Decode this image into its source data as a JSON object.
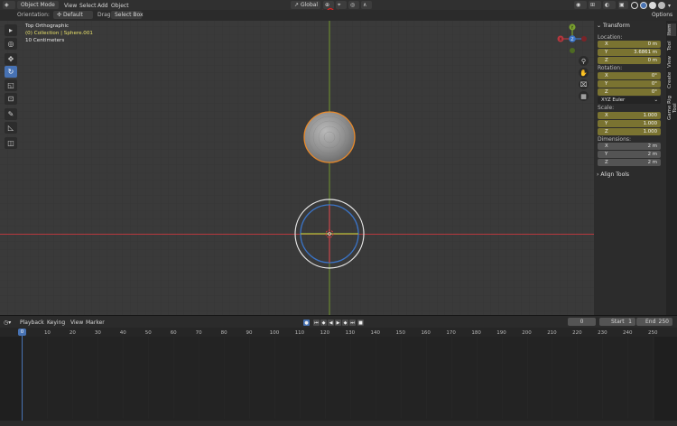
{
  "header": {
    "mode": "Object Mode",
    "menus": [
      "View",
      "Select",
      "Add",
      "Object"
    ],
    "transform_orientation": "Global",
    "options_label": "Options"
  },
  "tool_header": {
    "orientation_label": "Orientation:",
    "orientation_value": "Default",
    "drag_label": "Drag:",
    "drag_value": "Select Box"
  },
  "viewport": {
    "view_name": "Top Orthographic",
    "collection_info": "(0) Collection | Sphere.001",
    "scale_info": "10 Centimeters",
    "gizmo_labels": {
      "x": "X",
      "y": "Y",
      "z": "Z"
    }
  },
  "toolbar": {
    "tools": [
      "select-box",
      "cursor",
      "move",
      "rotate",
      "scale",
      "transform",
      "annotate",
      "measure",
      "add-cube"
    ],
    "active_index": 3
  },
  "sidebar": {
    "panel_title": "Transform",
    "location": {
      "label": "Location:",
      "x": "0 m",
      "y": "3.6861 m",
      "z": "0 m"
    },
    "rotation": {
      "label": "Rotation:",
      "x": "0°",
      "y": "0°",
      "z": "0°",
      "mode": "XYZ Euler"
    },
    "scale": {
      "label": "Scale:",
      "x": "1.000",
      "y": "1.000",
      "z": "1.000"
    },
    "dimensions": {
      "label": "Dimensions:",
      "x": "2 m",
      "y": "2 m",
      "z": "2 m"
    },
    "axis": {
      "x": "X",
      "y": "Y",
      "z": "Z"
    },
    "align_tools": "Align Tools",
    "tabs": [
      "Item",
      "Tool",
      "View",
      "Create",
      "Game Rig Tool"
    ]
  },
  "timeline": {
    "menus": [
      "Playback",
      "Keying",
      "View",
      "Marker"
    ],
    "current_frame": "0",
    "start_label": "Start",
    "start_value": "1",
    "end_label": "End",
    "end_value": "250",
    "ticks": [
      "0",
      "10",
      "20",
      "30",
      "40",
      "50",
      "60",
      "70",
      "80",
      "90",
      "100",
      "110",
      "120",
      "130",
      "140",
      "150",
      "160",
      "170",
      "180",
      "190",
      "200",
      "210",
      "220",
      "230",
      "240",
      "250"
    ]
  },
  "colors": {
    "accent": "#4772b3",
    "selected_outline": "#e8892a",
    "x_axis": "#b7383f",
    "y_axis": "#7aa12f",
    "z_axis": "#3a74c8",
    "location_field": "#7a7331"
  }
}
